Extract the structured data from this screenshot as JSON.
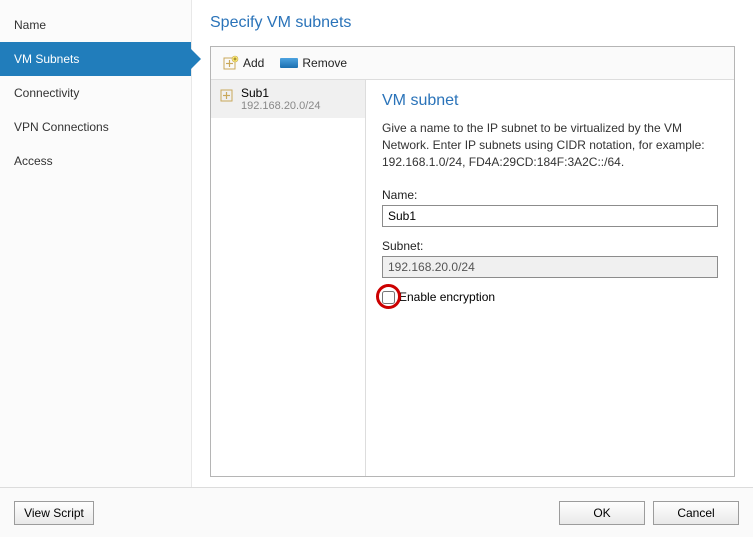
{
  "sidebar": {
    "items": [
      {
        "label": "Name"
      },
      {
        "label": "VM Subnets"
      },
      {
        "label": "Connectivity"
      },
      {
        "label": "VPN Connections"
      },
      {
        "label": "Access"
      }
    ],
    "selectedIndex": 1
  },
  "page": {
    "title": "Specify VM subnets"
  },
  "toolbar": {
    "add_label": "Add",
    "remove_label": "Remove"
  },
  "subnet_list": [
    {
      "name": "Sub1",
      "cidr": "192.168.20.0/24"
    }
  ],
  "detail": {
    "title": "VM subnet",
    "description": "Give a name to the IP subnet to be virtualized by the VM Network. Enter IP subnets using CIDR notation, for example: 192.168.1.0/24, FD4A:29CD:184F:3A2C::/64.",
    "name_label": "Name:",
    "name_value": "Sub1",
    "subnet_label": "Subnet:",
    "subnet_value": "192.168.20.0/24",
    "encryption_label": "Enable encryption",
    "encryption_checked": false
  },
  "footer": {
    "view_script": "View Script",
    "ok": "OK",
    "cancel": "Cancel"
  },
  "colors": {
    "accent": "#217dbb",
    "heading": "#2a73b9",
    "highlight_ring": "#c00"
  }
}
